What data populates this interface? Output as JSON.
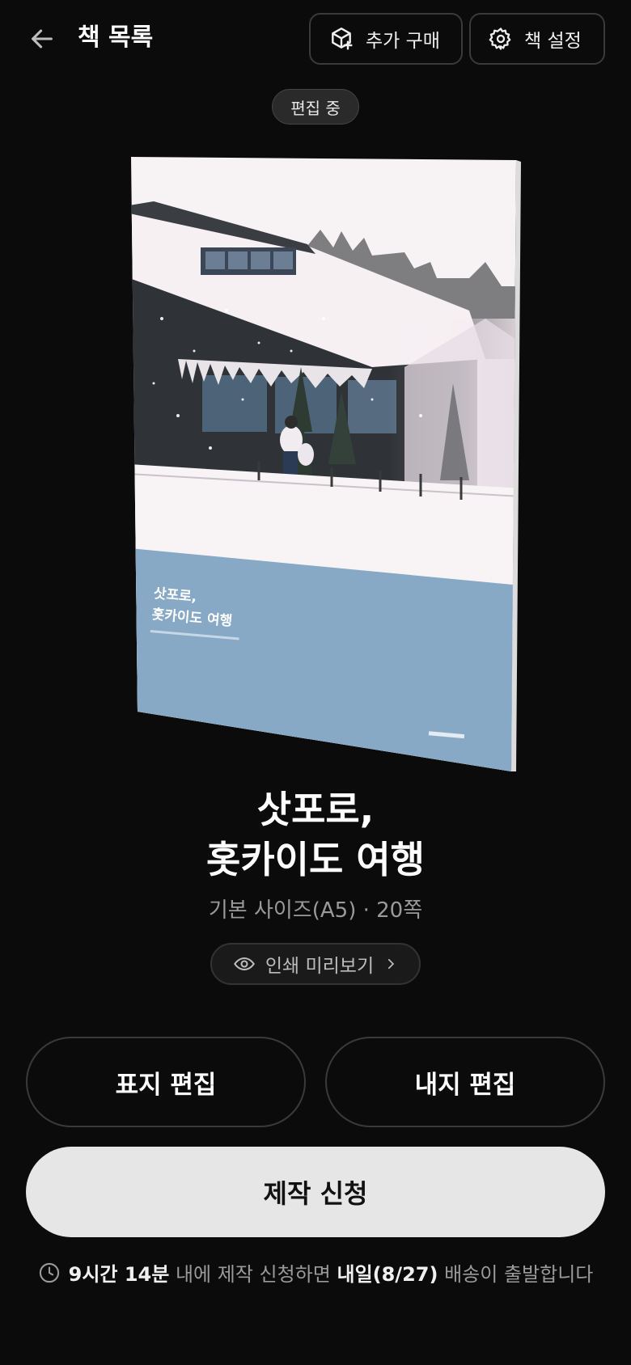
{
  "header": {
    "title": "책 목록",
    "buy_label": "추가 구매",
    "settings_label": "책 설정"
  },
  "status_badge": "편집 중",
  "cover": {
    "title_line1": "삿포로,",
    "title_line2": "홋카이도 여행",
    "band_color": "#87a9c6"
  },
  "book": {
    "title_line1": "삿포로,",
    "title_line2": "홋카이도 여행",
    "meta": "기본 사이즈(A5) · 20쪽",
    "preview_label": "인쇄 미리보기"
  },
  "actions": {
    "cover_edit": "표지 편집",
    "inner_edit": "내지 편집",
    "submit": "제작 신청"
  },
  "notice": {
    "time": "9시간 14분",
    "mid": " 내에 제작 신청하면 ",
    "date": "내일(8/27)",
    "end": " 배송이 출발합니다"
  }
}
